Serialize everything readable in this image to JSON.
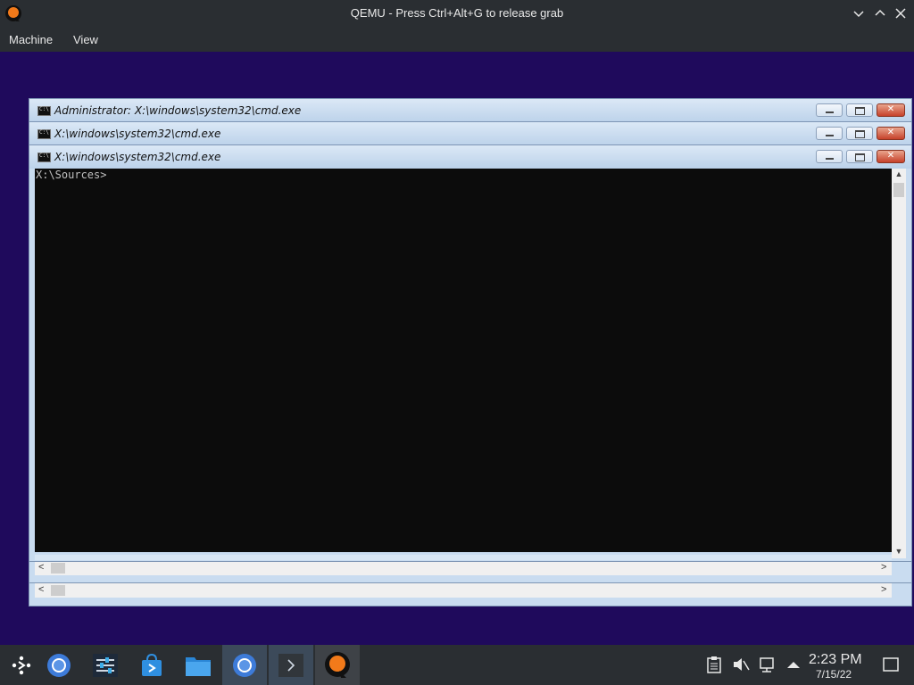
{
  "window": {
    "title": "QEMU - Press Ctrl+Alt+G to release grab"
  },
  "menu": {
    "machine": "Machine",
    "view": "View"
  },
  "guest": {
    "windows": [
      {
        "title": "Administrator: X:\\windows\\system32\\cmd.exe"
      },
      {
        "title": "X:\\windows\\system32\\cmd.exe"
      },
      {
        "title": "X:\\windows\\system32\\cmd.exe"
      }
    ],
    "console_prompt": "X:\\Sources>"
  },
  "taskbar": {
    "items": [
      "app-launcher-icon",
      "browser-icon",
      "settings-mixer-icon",
      "store-icon",
      "file-manager-icon",
      "browser-icon",
      "terminal-icon",
      "qemu-icon"
    ],
    "clock_time": "2:23 PM",
    "clock_date": "7/15/22"
  },
  "colors": {
    "vm_background": "#1f0a5c",
    "host_chrome": "#2a2e32",
    "accent": "#3daee9"
  }
}
